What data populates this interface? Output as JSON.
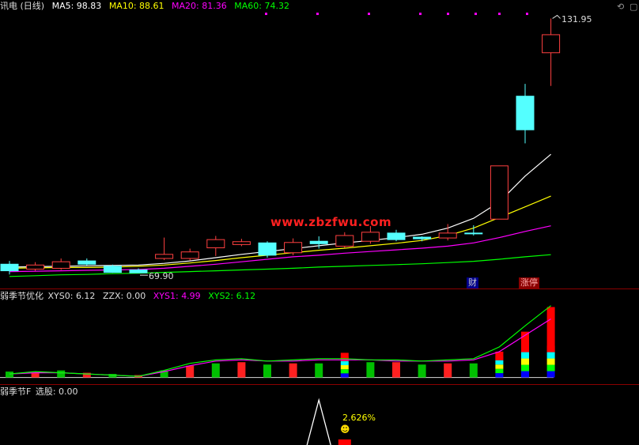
{
  "main_header": {
    "title": "讯电 (日线)",
    "ma5_label": "MA5: 98.83",
    "ma10_label": "MA10: 88.61",
    "ma20_label": "MA20: 81.36",
    "ma60_label": "MA60: 74.32"
  },
  "watermark": "www.zbzfwu.com",
  "indicator1_header": {
    "name": "弱季节优化",
    "xys0_label": "XYS0: 6.12",
    "zzx_label": "ZZX: 0.00",
    "xys1_label": "XYS1: 4.99",
    "xys2_label": "XYS2: 6.12"
  },
  "indicator2_header": {
    "name": "弱季节F",
    "pick_label": "选股: 0.00"
  },
  "annotations": {
    "high_price": "131.95",
    "low_price": "69.90",
    "finance_tag": "财",
    "limit_up_tag": "涨停",
    "pct_label": "2.626%"
  },
  "colors": {
    "up": "#ff4040",
    "down": "#54ffff",
    "ma5": "#ffffff",
    "ma10": "#ffff00",
    "ma20": "#ff00ff",
    "ma60": "#00ff00",
    "divider": "#8b0000"
  },
  "chart_data": {
    "type": "candlestick",
    "candles": [
      {
        "o": 72.0,
        "c": 70.4,
        "h": 72.8,
        "l": 69.5
      },
      {
        "o": 70.8,
        "c": 71.8,
        "h": 72.5,
        "l": 70.4
      },
      {
        "o": 71.0,
        "c": 72.6,
        "h": 73.4,
        "l": 70.6
      },
      {
        "o": 72.8,
        "c": 72.0,
        "h": 73.4,
        "l": 71.7
      },
      {
        "o": 71.5,
        "c": 70.0,
        "h": 71.9,
        "l": 69.9
      },
      {
        "o": 70.6,
        "c": 69.9,
        "h": 71.0,
        "l": 69.9
      },
      {
        "o": 73.4,
        "c": 74.4,
        "h": 78.5,
        "l": 73.0
      },
      {
        "o": 73.4,
        "c": 75.0,
        "h": 75.8,
        "l": 72.9
      },
      {
        "o": 76.0,
        "c": 78.0,
        "h": 78.9,
        "l": 74.0
      },
      {
        "o": 76.8,
        "c": 77.5,
        "h": 78.2,
        "l": 76.4
      },
      {
        "o": 77.2,
        "c": 74.2,
        "h": 77.6,
        "l": 73.6
      },
      {
        "o": 74.8,
        "c": 77.3,
        "h": 78.3,
        "l": 74.2
      },
      {
        "o": 77.6,
        "c": 77.0,
        "h": 78.8,
        "l": 75.8
      },
      {
        "o": 76.4,
        "c": 79.0,
        "h": 79.8,
        "l": 76.0
      },
      {
        "o": 77.6,
        "c": 79.8,
        "h": 81.3,
        "l": 77.0
      },
      {
        "o": 79.6,
        "c": 78.0,
        "h": 80.4,
        "l": 77.6
      },
      {
        "o": 78.6,
        "c": 78.2,
        "h": 78.8,
        "l": 77.6
      },
      {
        "o": 78.4,
        "c": 79.6,
        "h": 81.8,
        "l": 77.8
      },
      {
        "o": 79.6,
        "c": 79.5,
        "h": 81.5,
        "l": 79.0
      },
      {
        "o": 83.0,
        "c": 96.0,
        "h": 96.0,
        "l": 83.0
      },
      {
        "o": 113.0,
        "c": 104.8,
        "h": 116.0,
        "l": 101.5
      },
      {
        "o": 123.6,
        "c": 128.0,
        "h": 131.95,
        "l": 115.5
      }
    ],
    "ma5": [
      71.3,
      71.4,
      71.5,
      71.6,
      71.7,
      71.8,
      72.2,
      72.8,
      73.6,
      74.4,
      75.1,
      75.8,
      76.5,
      77.2,
      77.8,
      78.5,
      79.3,
      80.8,
      83.2,
      87.2,
      93.5,
      98.83
    ],
    "ma10": [
      71.0,
      71.1,
      71.2,
      71.2,
      71.3,
      71.5,
      71.8,
      72.3,
      72.9,
      73.6,
      74.2,
      74.8,
      75.4,
      75.9,
      76.5,
      77.1,
      77.8,
      79.0,
      80.8,
      83.4,
      86.0,
      88.61
    ],
    "ma20": [
      70.2,
      70.3,
      70.4,
      70.5,
      70.6,
      70.7,
      71.0,
      71.5,
      72.0,
      72.6,
      73.2,
      73.8,
      74.2,
      74.7,
      75.1,
      75.5,
      75.9,
      76.4,
      77.2,
      78.5,
      80.0,
      81.36
    ],
    "ma60": [
      69.0,
      69.2,
      69.4,
      69.5,
      69.7,
      69.8,
      70.0,
      70.2,
      70.4,
      70.6,
      70.8,
      71.0,
      71.3,
      71.5,
      71.7,
      71.9,
      72.1,
      72.4,
      72.7,
      73.2,
      73.8,
      74.32
    ],
    "y_range": [
      68,
      133
    ],
    "ind1": {
      "xys0": [
        0.3,
        0.5,
        0.4,
        0.3,
        0.2,
        0.1,
        0.6,
        1.2,
        1.5,
        1.6,
        1.4,
        1.5,
        1.6,
        1.6,
        1.5,
        1.5,
        1.4,
        1.5,
        1.6,
        2.6,
        4.4,
        6.12
      ],
      "xys1": [
        0.3,
        0.4,
        0.4,
        0.3,
        0.2,
        0.1,
        0.5,
        1.0,
        1.4,
        1.5,
        1.4,
        1.4,
        1.5,
        1.5,
        1.5,
        1.4,
        1.4,
        1.4,
        1.5,
        2.2,
        3.6,
        4.99
      ],
      "bars": [
        0.5,
        0.4,
        0.6,
        0.4,
        0.3,
        0.2,
        0.6,
        1.0,
        1.2,
        1.3,
        1.1,
        1.2,
        1.2,
        2.1,
        1.3,
        1.3,
        1.1,
        1.2,
        1.2,
        2.2,
        3.9,
        6.0
      ],
      "y_range": [
        -0.3,
        6.3
      ]
    },
    "ind2": {
      "peak_index": 12,
      "value_pct": 2.626
    }
  }
}
